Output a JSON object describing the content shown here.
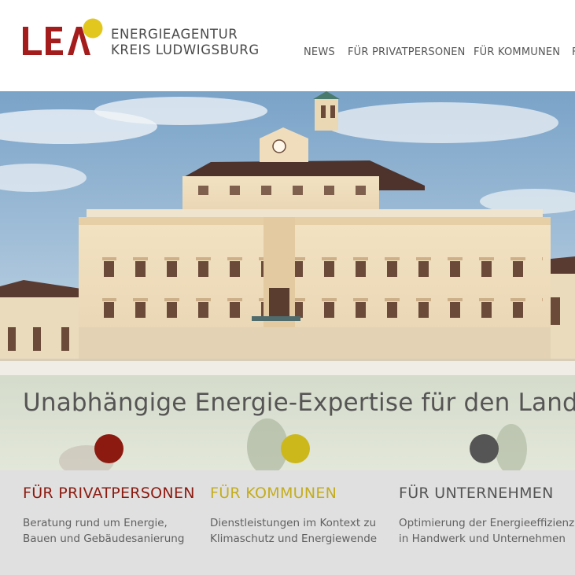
{
  "header": {
    "logo_letters": "LEA",
    "org_line1": "ENERGIEAGENTUR",
    "org_line2": "KREIS LUDWIGSBURG"
  },
  "nav": {
    "items": [
      {
        "label": "NEWS"
      },
      {
        "label": "FÜR PRIVATPERSONEN"
      },
      {
        "label": "FÜR KOMMUNEN"
      },
      {
        "label": "F"
      }
    ]
  },
  "hero": {
    "tagline": "Unabhängige Energie-Expertise für den Landkre"
  },
  "colors": {
    "brand_red": "#a01b1b",
    "brand_yellow": "#d8c21a",
    "private_red": "#8c1a10",
    "commune_yellow": "#cdb81c",
    "business_gray": "#555555"
  },
  "sections": [
    {
      "title": "FÜR PRIVATPERSONEN",
      "line1": "Beratung rund um Energie,",
      "line2": "Bauen und Gebäudesanierung"
    },
    {
      "title": "FÜR KOMMUNEN",
      "line1": "Dienstleistungen im Kontext zu",
      "line2": "Klimaschutz und Energiewende"
    },
    {
      "title": "FÜR UNTERNEHMEN",
      "line1": "Optimierung der Energieeffizienz",
      "line2": "in Handwerk und Unternehmen"
    }
  ]
}
